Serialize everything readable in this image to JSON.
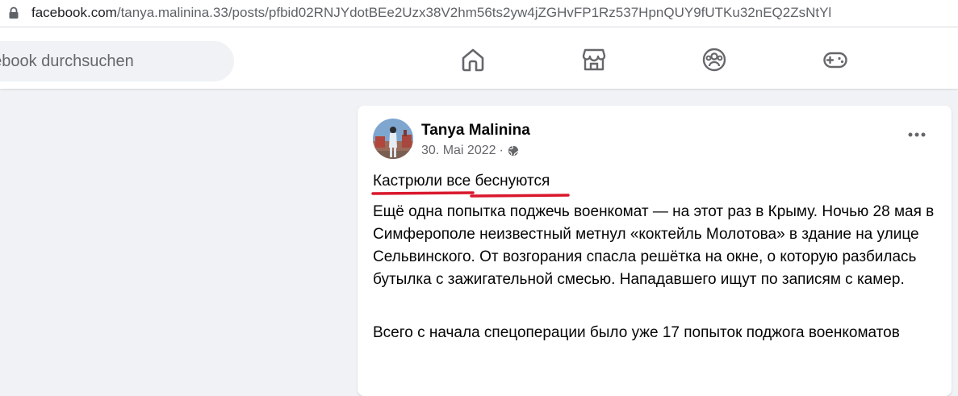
{
  "browser": {
    "url_host": "facebook.com",
    "url_path": "/tanya.malinina.33/posts/pfbid02RNJYdotBEe2Uzx38V2hm56ts2yw4jZGHvFP1Rz537HpnQUY9fUTKu32nEQ2ZsNtYl"
  },
  "header": {
    "search_placeholder": "acebook durchsuchen",
    "nav_icons": [
      "home-icon",
      "marketplace-icon",
      "groups-icon",
      "gaming-icon"
    ]
  },
  "post": {
    "author": "Tanya Malinina",
    "date": "30. Mai 2022",
    "separator": "·",
    "title": "Кастрюли все беснуются",
    "paragraphs": [
      "Ещё одна попытка поджечь военкомат — на этот раз в Крыму. Ночью 28 мая в Симферополе неизвестный метнул «коктейль Молотова» в здание на улице Сельвинского. От возгорания спасла решётка на окне, о которую разбилась бутылка с зажигательной смесью. Нападавшего ищут по записям с камер.",
      "Всего с начала спецоперации было уже 17 попыток поджога военкоматов"
    ]
  },
  "colors": {
    "facebook_bg": "#f0f2f5",
    "annotation_red": "#d9182d",
    "icon_gray": "#65676b"
  }
}
